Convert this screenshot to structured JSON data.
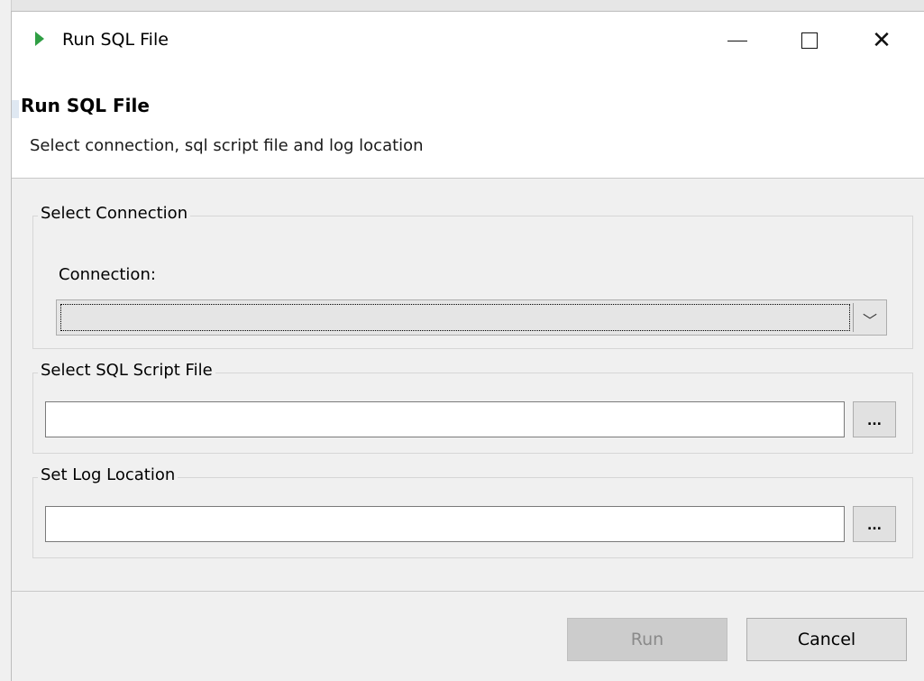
{
  "window": {
    "title": "Run SQL File",
    "icon": "play-triangle-icon",
    "controls": {
      "minimize": "minimize-icon",
      "maximize": "maximize-icon",
      "close_glyph": "✕"
    }
  },
  "header": {
    "title": "Run SQL File",
    "subtitle": "Select connection, sql script file and log location"
  },
  "groups": {
    "connection": {
      "legend": "Select Connection",
      "label": "Connection:",
      "selected_value": "",
      "dropdown_arrow": "﹀"
    },
    "sql_script": {
      "legend": "Select SQL Script File",
      "value": "",
      "browse_label": "..."
    },
    "log_location": {
      "legend": "Set Log Location",
      "value": "",
      "browse_label": "..."
    }
  },
  "buttons": {
    "run": "Run",
    "cancel": "Cancel"
  },
  "colors": {
    "run_icon": "#2f9e44",
    "disabled_button_bg": "#cccccc",
    "disabled_button_text": "#8a8a8a"
  }
}
